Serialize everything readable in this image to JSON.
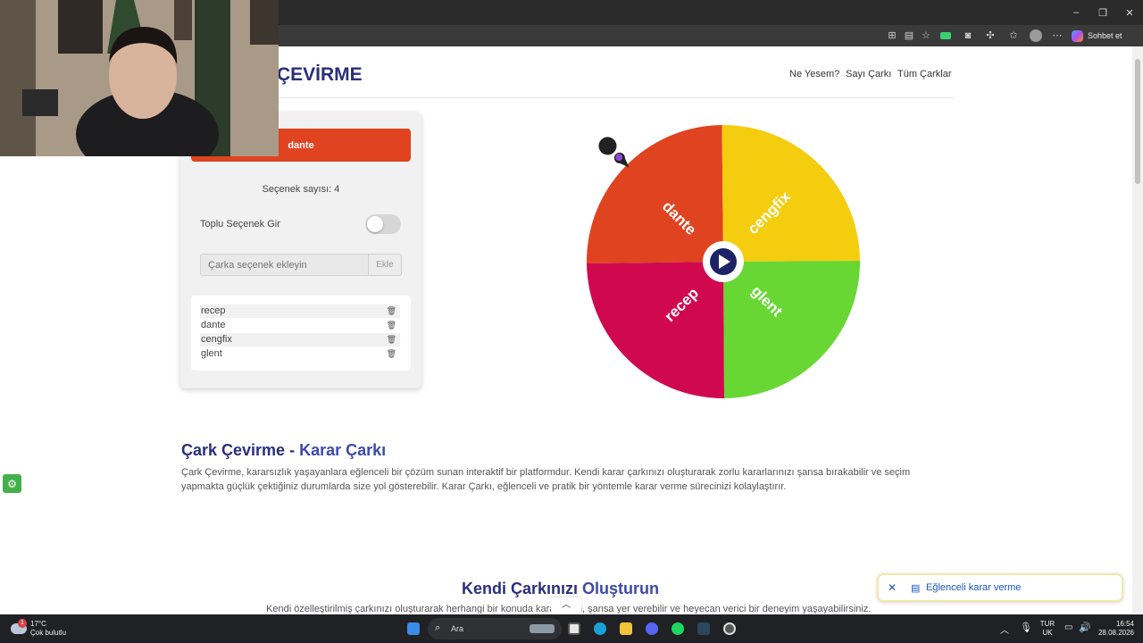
{
  "browser": {
    "window_controls": [
      "–",
      "❐",
      "✕"
    ],
    "copilot_label": "Sohbet et"
  },
  "site": {
    "brand": "ÇEVİRME",
    "nav": [
      "Ne Yesem?",
      "Sayı Çarkı",
      "Tüm Çarklar"
    ]
  },
  "panel": {
    "winner": "dante",
    "count_text": "Seçenek sayısı: 4",
    "bulk_label": "Toplu Seçenek Gir",
    "bulk_enabled": false,
    "input_placeholder": "Çarka seçenek ekleyin",
    "add_label": "Ekle",
    "items": [
      "recep",
      "dante",
      "cengfix",
      "glent"
    ]
  },
  "wheel": {
    "segments": [
      {
        "label": "dante",
        "color": "#e04320"
      },
      {
        "label": "cengfix",
        "color": "#f5cd0f"
      },
      {
        "label": "glent",
        "color": "#68d733"
      },
      {
        "label": "recep",
        "color": "#d0094f"
      }
    ],
    "hub_color": "#1e2266"
  },
  "article": {
    "title_main": "Çark Çevirme - ",
    "title_accent": "Karar Çarkı",
    "paragraph": "Çark Çevirme, kararsızlık yaşayanlara eğlenceli bir çözüm sunan interaktif bir platformdur. Kendi karar çarkınızı oluşturarak zorlu kararlarınızı şansa bırakabilir ve seçim yapmakta güçlük çektiğiniz durumlarda size yol gösterebilir. Karar Çarkı, eğlenceli ve pratik bir yöntemle karar verme sürecinizi kolaylaştırır.",
    "section2_main": "Kendi Çarkınızı ",
    "section2_accent": "Oluşturun",
    "section2_text": "Kendi özelleştirilmiş çarkınızı oluşturarak herhangi bir konuda karar verin, şansa yer verebilir ve heyecan verici bir deneyim yaşayabilirsiniz."
  },
  "toast": {
    "text": "Eğlenceli karar verme"
  },
  "taskbar": {
    "temperature": "17°C",
    "condition": "Çok bulutlu",
    "weather_badge": "1",
    "search_label": "Ara",
    "lang_top": "TUR",
    "lang_bottom": "UK",
    "time": "16:54",
    "date": "28.08.2026"
  }
}
